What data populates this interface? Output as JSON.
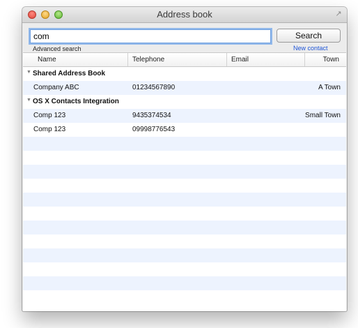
{
  "window": {
    "title": "Address book",
    "fullscreen_glyph": "↗"
  },
  "search": {
    "value": "com",
    "placeholder": "",
    "button_label": "Search",
    "advanced_label": "Advanced search",
    "new_contact_label": "New contact"
  },
  "table": {
    "columns": [
      "Name",
      "Telephone",
      "Email",
      "Town"
    ],
    "groups": [
      {
        "label": "Shared Address Book",
        "rows": [
          {
            "name": "Company ABC",
            "telephone": "01234567890",
            "email": "",
            "town": "A Town"
          }
        ]
      },
      {
        "label": "OS X Contacts Integration",
        "rows": [
          {
            "name": "Comp 123",
            "telephone": "9435374534",
            "email": "",
            "town": "Small Town"
          },
          {
            "name": "Comp 123",
            "telephone": "09998776543",
            "email": "",
            "town": ""
          }
        ]
      }
    ]
  },
  "icons": {
    "close": "close-icon",
    "minimize": "minimize-icon",
    "zoom": "zoom-icon",
    "fullscreen": "fullscreen-icon",
    "disclosure": "disclosure-triangle-icon"
  }
}
